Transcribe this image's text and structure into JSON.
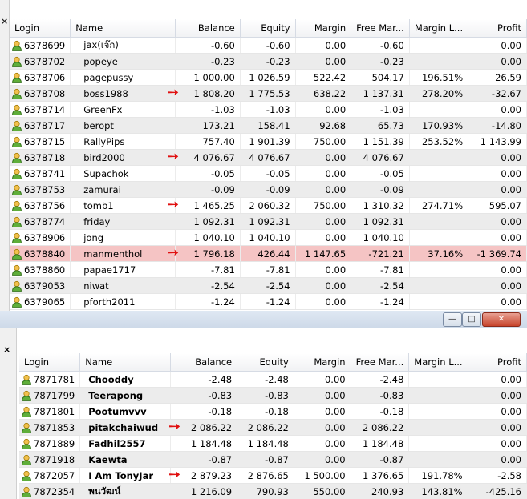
{
  "close_glyph": "×",
  "headers": [
    "Login",
    "Name",
    "Balance",
    "Equity",
    "Margin",
    "Free Mar...",
    "Margin L...",
    "Profit"
  ],
  "top_rows": [
    {
      "login": "6378699",
      "name": "jax(เจ๊ก)",
      "balance": "-0.60",
      "equity": "-0.60",
      "margin": "0.00",
      "free": "-0.60",
      "level": "",
      "profit": "0.00"
    },
    {
      "login": "6378702",
      "name": "popeye",
      "balance": "-0.23",
      "equity": "-0.23",
      "margin": "0.00",
      "free": "-0.23",
      "level": "",
      "profit": "0.00"
    },
    {
      "login": "6378706",
      "name": "pagepussy",
      "balance": "1 000.00",
      "equity": "1 026.59",
      "margin": "522.42",
      "free": "504.17",
      "level": "196.51%",
      "profit": "26.59"
    },
    {
      "login": "6378708",
      "name": "boss1988",
      "balance": "1 808.20",
      "equity": "1 775.53",
      "margin": "638.22",
      "free": "1 137.31",
      "level": "278.20%",
      "profit": "-32.67",
      "arrow": true
    },
    {
      "login": "6378714",
      "name": "GreenFx",
      "balance": "-1.03",
      "equity": "-1.03",
      "margin": "0.00",
      "free": "-1.03",
      "level": "",
      "profit": "0.00"
    },
    {
      "login": "6378717",
      "name": "beropt",
      "balance": "173.21",
      "equity": "158.41",
      "margin": "92.68",
      "free": "65.73",
      "level": "170.93%",
      "profit": "-14.80"
    },
    {
      "login": "6378715",
      "name": "RallyPips",
      "balance": "757.40",
      "equity": "1 901.39",
      "margin": "750.00",
      "free": "1 151.39",
      "level": "253.52%",
      "profit": "1 143.99"
    },
    {
      "login": "6378718",
      "name": "bird2000",
      "balance": "4 076.67",
      "equity": "4 076.67",
      "margin": "0.00",
      "free": "4 076.67",
      "level": "",
      "profit": "0.00",
      "arrow": true
    },
    {
      "login": "6378741",
      "name": "Supachok",
      "balance": "-0.05",
      "equity": "-0.05",
      "margin": "0.00",
      "free": "-0.05",
      "level": "",
      "profit": "0.00"
    },
    {
      "login": "6378753",
      "name": "zamurai",
      "balance": "-0.09",
      "equity": "-0.09",
      "margin": "0.00",
      "free": "-0.09",
      "level": "",
      "profit": "0.00"
    },
    {
      "login": "6378756",
      "name": "tomb1",
      "balance": "1 465.25",
      "equity": "2 060.32",
      "margin": "750.00",
      "free": "1 310.32",
      "level": "274.71%",
      "profit": "595.07",
      "arrow": true
    },
    {
      "login": "6378774",
      "name": "friday",
      "balance": "1 092.31",
      "equity": "1 092.31",
      "margin": "0.00",
      "free": "1 092.31",
      "level": "",
      "profit": "0.00"
    },
    {
      "login": "6378906",
      "name": "jong",
      "balance": "1 040.10",
      "equity": "1 040.10",
      "margin": "0.00",
      "free": "1 040.10",
      "level": "",
      "profit": "0.00"
    },
    {
      "login": "6378840",
      "name": "manmenthol",
      "balance": "1 796.18",
      "equity": "426.44",
      "margin": "1 147.65",
      "free": "-721.21",
      "level": "37.16%",
      "profit": "-1 369.74",
      "arrow": true,
      "warn": true
    },
    {
      "login": "6378860",
      "name": "papae1717",
      "balance": "-7.81",
      "equity": "-7.81",
      "margin": "0.00",
      "free": "-7.81",
      "level": "",
      "profit": "0.00"
    },
    {
      "login": "6379053",
      "name": "niwat",
      "balance": "-2.54",
      "equity": "-2.54",
      "margin": "0.00",
      "free": "-2.54",
      "level": "",
      "profit": "0.00"
    },
    {
      "login": "6379065",
      "name": "pforth2011",
      "balance": "-1.24",
      "equity": "-1.24",
      "margin": "0.00",
      "free": "-1.24",
      "level": "",
      "profit": "0.00"
    }
  ],
  "bottom_rows": [
    {
      "login": "7871781",
      "name": "Chooddy",
      "balance": "-2.48",
      "equity": "-2.48",
      "margin": "0.00",
      "free": "-2.48",
      "level": "",
      "profit": "0.00"
    },
    {
      "login": "7871799",
      "name": "Teerapong",
      "balance": "-0.83",
      "equity": "-0.83",
      "margin": "0.00",
      "free": "-0.83",
      "level": "",
      "profit": "0.00"
    },
    {
      "login": "7871801",
      "name": "Pootumvvv",
      "balance": "-0.18",
      "equity": "-0.18",
      "margin": "0.00",
      "free": "-0.18",
      "level": "",
      "profit": "0.00"
    },
    {
      "login": "7871853",
      "name": "pitakchaiwud",
      "balance": "2 086.22",
      "equity": "2 086.22",
      "margin": "0.00",
      "free": "2 086.22",
      "level": "",
      "profit": "0.00",
      "arrow": true
    },
    {
      "login": "7871889",
      "name": "Fadhil2557",
      "balance": "1 184.48",
      "equity": "1 184.48",
      "margin": "0.00",
      "free": "1 184.48",
      "level": "",
      "profit": "0.00"
    },
    {
      "login": "7871918",
      "name": "Kaewta",
      "balance": "-0.87",
      "equity": "-0.87",
      "margin": "0.00",
      "free": "-0.87",
      "level": "",
      "profit": "0.00"
    },
    {
      "login": "7872057",
      "name": "I Am TonyJar",
      "balance": "2 879.23",
      "equity": "2 876.65",
      "margin": "1 500.00",
      "free": "1 376.65",
      "level": "191.78%",
      "profit": "-2.58",
      "arrow": true
    },
    {
      "login": "7872354",
      "name": "พนวัฒน์",
      "balance": "1 216.09",
      "equity": "790.93",
      "margin": "550.00",
      "free": "240.93",
      "level": "143.81%",
      "profit": "-425.16"
    }
  ],
  "window_buttons": {
    "minimize": "—",
    "maximize": "□",
    "close": "✕"
  },
  "arrow_glyph": "➙",
  "colors": {
    "warn_row": "#f5c4c4",
    "arrow": "#e01010"
  }
}
